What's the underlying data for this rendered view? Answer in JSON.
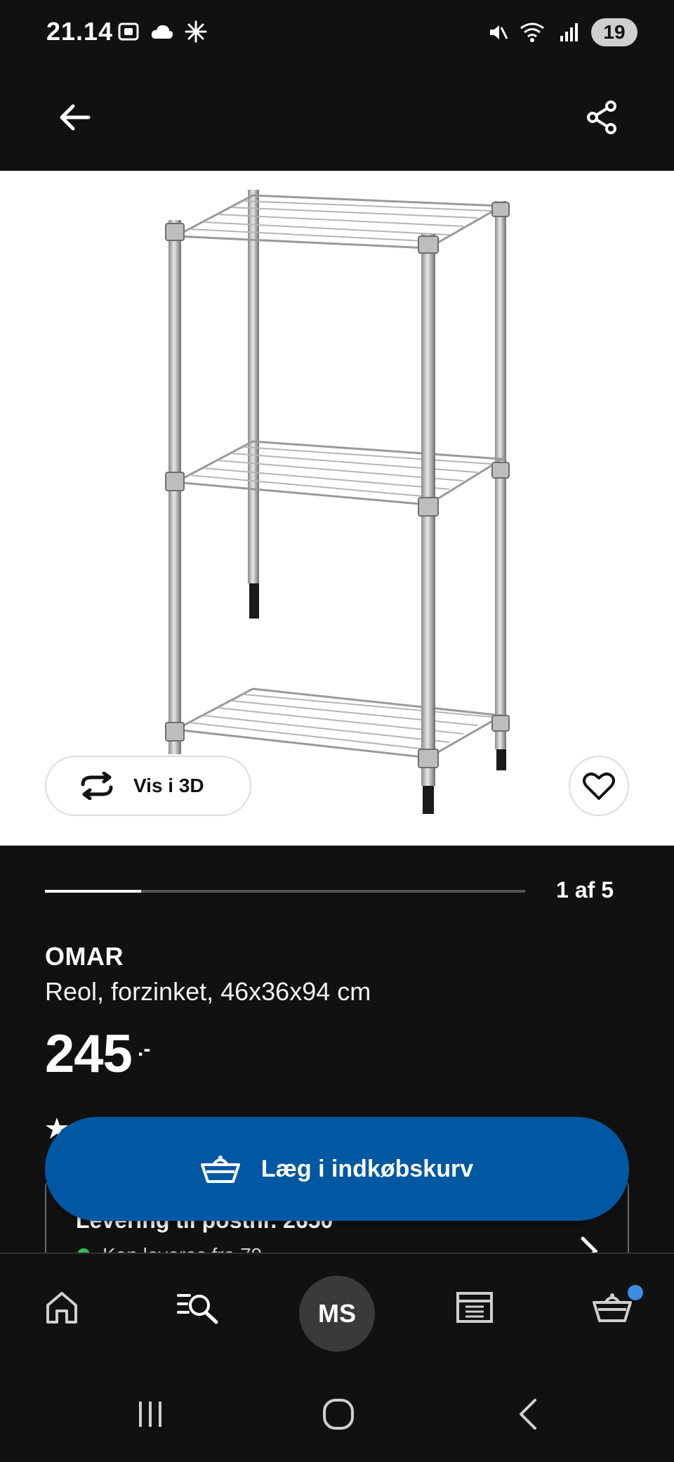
{
  "status_bar": {
    "time": "21.14",
    "battery": "19"
  },
  "app_bar": {
    "back_icon": "arrow-left-icon",
    "share_icon": "share-icon"
  },
  "gallery": {
    "view_3d_label": "Vis i 3D",
    "current_image": 1,
    "total_images": 5,
    "counter_text": "1 af 5",
    "progress_fraction": 0.2
  },
  "product": {
    "name": "OMAR",
    "description": "Reol, forzinket, 46x36x94 cm",
    "price": "245",
    "price_suffix": ".-"
  },
  "delivery": {
    "title": "Levering til postnr. 2650",
    "status": "Kan leveres fra 79"
  },
  "cart_button": {
    "label": "Læg i indkøbskurv"
  },
  "bottom_nav": {
    "avatar_initials": "MS"
  },
  "colors": {
    "primary_blue": "#0058a3",
    "badge_blue": "#3a8de0",
    "available_green": "#2fbf4e",
    "background": "#111111"
  }
}
